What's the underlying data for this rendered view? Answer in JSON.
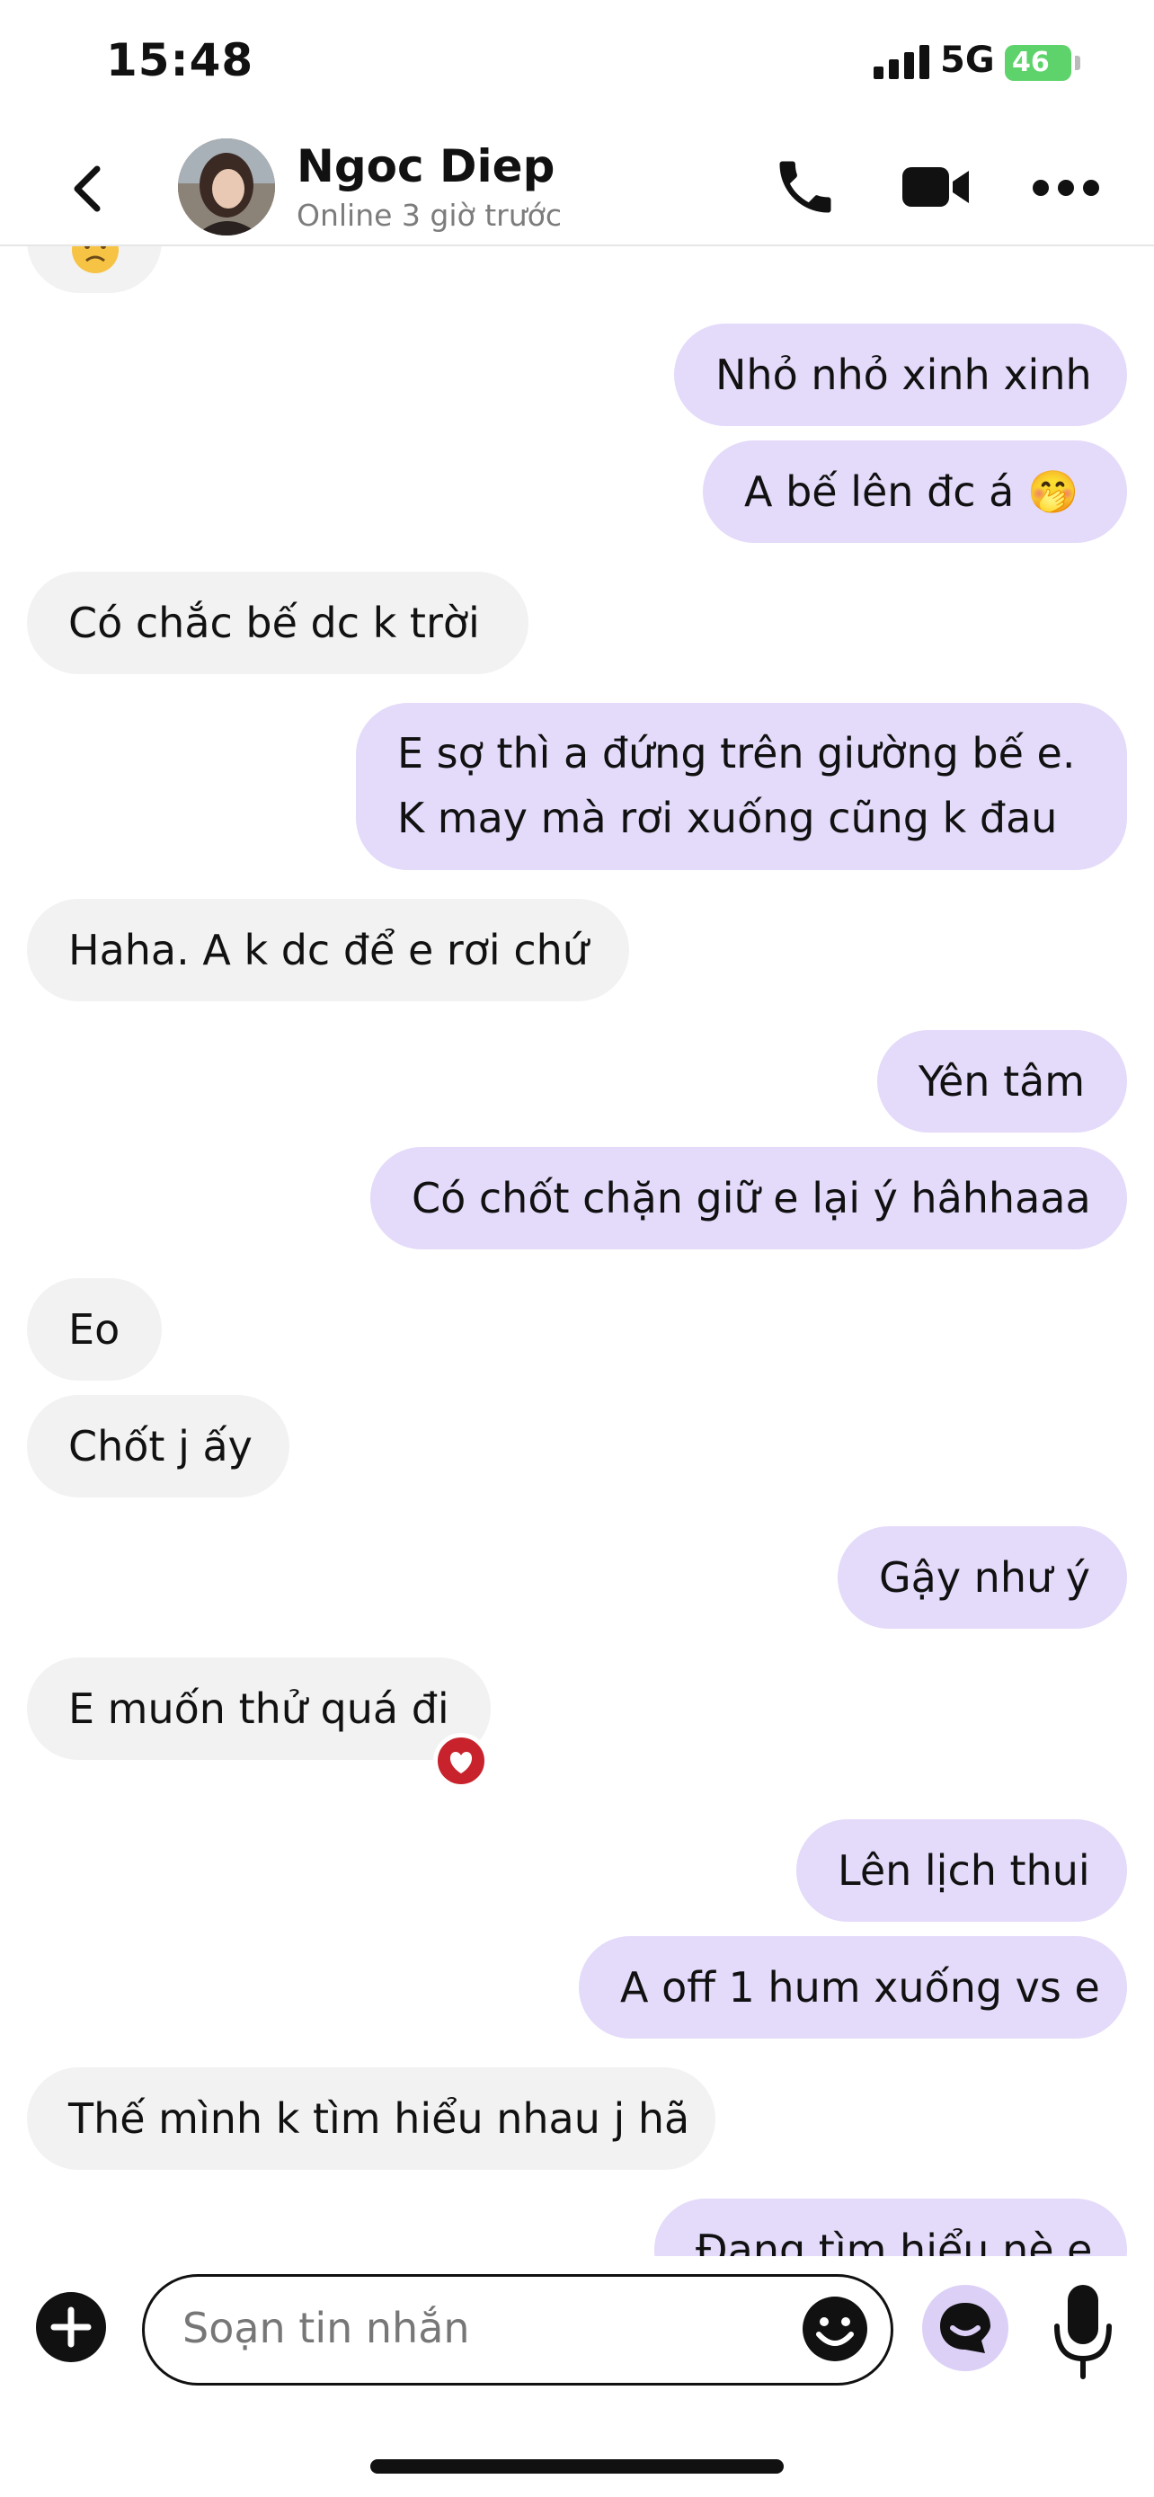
{
  "status_bar": {
    "time": "15:48",
    "network": "5G",
    "battery": "46"
  },
  "header": {
    "contact_name": "Ngoc Diep",
    "contact_status": "Online 3 giờ trước"
  },
  "messages": [
    {
      "direction": "out",
      "text": "Nhỏ nhỏ xinh xinh"
    },
    {
      "direction": "out",
      "text": "A bế lên đc á 🤭"
    },
    {
      "direction": "in",
      "text": "Có chắc bế dc k trời"
    },
    {
      "direction": "out",
      "lines": [
        "E sợ thì a đứng trên giường bế e.",
        "K may mà rơi xuống cũng k đau"
      ]
    },
    {
      "direction": "in",
      "text": "Haha. A k dc để e rơi chứ"
    },
    {
      "direction": "out",
      "text": "Yên tâm"
    },
    {
      "direction": "out",
      "text": "Có chốt chặn giữ e lại ý hâhhaaa"
    },
    {
      "direction": "in",
      "text": "Eo"
    },
    {
      "direction": "in",
      "text": "Chốt j ấy"
    },
    {
      "direction": "out",
      "text": "Gậy như ý"
    },
    {
      "direction": "in",
      "text": "E muốn thử quá đi",
      "reaction": "heart-reaction-icon"
    },
    {
      "direction": "out",
      "text": "Lên lịch thui"
    },
    {
      "direction": "out",
      "text": "A off 1 hum xuống vs e"
    },
    {
      "direction": "in",
      "text": "Thế mình k tìm hiểu nhau j hã"
    },
    {
      "direction": "out",
      "text": "Đang tìm hiểu nè e"
    }
  ],
  "composer": {
    "placeholder": "Soạn tin nhắn"
  },
  "colors": {
    "incoming_bubble": "#f2f2f2",
    "outgoing_bubble": "#e4dafa",
    "accent": "#dcd0f7",
    "reaction": "#c8232c"
  },
  "icons": [
    "back-icon",
    "phone-icon",
    "video-camera-icon",
    "more-icon",
    "plus-icon",
    "smile-icon",
    "ai-assistant-icon",
    "microphone-icon"
  ]
}
